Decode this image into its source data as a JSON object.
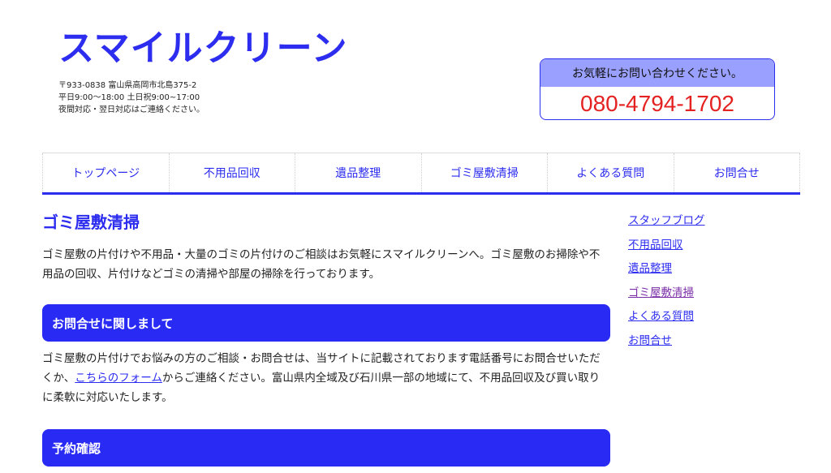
{
  "header": {
    "brand": "スマイルクリーン",
    "address_lines": [
      "〒933-0838 富山県高岡市北島375-2",
      "平日9:00〜18:00 土日祝9:00~17:00",
      "夜間対応・翌日対応はご連絡ください。"
    ],
    "contact_label": "お気軽にお問い合わせください。",
    "phone": "080-4794-1702"
  },
  "nav": {
    "items": [
      "トップページ",
      "不用品回収",
      "遺品整理",
      "ゴミ屋敷清掃",
      "よくある質問",
      "お問合せ"
    ]
  },
  "main": {
    "title": "ゴミ屋敷清掃",
    "intro": "ゴミ屋敷の片付けや不用品・大量のゴミの片付けのご相談はお気軽にスマイルクリーンへ。ゴミ屋敷のお掃除や不用品の回収、片付けなどゴミの清掃や部屋の掃除を行っております。",
    "section1_title": "お問合せに関しまして",
    "section1_text_before": "ゴミ屋敷の片付けでお悩みの方のご相談・お問合せは、当サイトに記載されております電話番号にお問合せいただくか、",
    "section1_link": "こちらのフォーム",
    "section1_text_after": "からご連絡ください。富山県内全域及び石川県一部の地域にて、不用品回収及び買い取りに柔軟に対応いたします。",
    "section2_title": "予約確認"
  },
  "sidebar": {
    "links": [
      "スタッフブログ",
      "不用品回収",
      "遺品整理",
      "ゴミ屋敷清掃",
      "よくある質問",
      "お問合せ"
    ]
  },
  "colors": {
    "accent": "#2d2df0",
    "phone": "#e52222",
    "contact_header": "#9aa0ff",
    "visited_link": "#7b2ea8"
  }
}
